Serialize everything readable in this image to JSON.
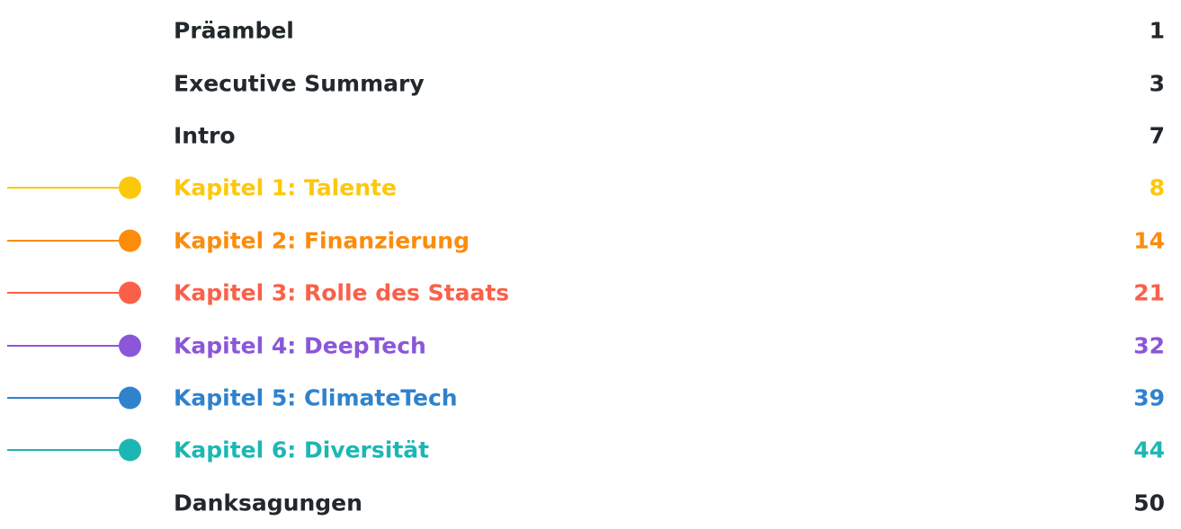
{
  "toc": {
    "entries": [
      {
        "title": "Präambel",
        "page": "1",
        "color": "#22282b",
        "marker": false
      },
      {
        "title": "Executive Summary",
        "page": "3",
        "color": "#22282b",
        "marker": false
      },
      {
        "title": "Intro",
        "page": "7",
        "color": "#22282b",
        "marker": false
      },
      {
        "title": "Kapitel 1: Talente",
        "page": "8",
        "color": "#fdc80a",
        "marker": true
      },
      {
        "title": "Kapitel 2: Finanzierung",
        "page": "14",
        "color": "#fb8c0c",
        "marker": true
      },
      {
        "title": "Kapitel 3: Rolle des Staats",
        "page": "21",
        "color": "#fa6048",
        "marker": true
      },
      {
        "title": "Kapitel 4: DeepTech",
        "page": "32",
        "color": "#8b57d8",
        "marker": true
      },
      {
        "title": "Kapitel 5: ClimateTech",
        "page": "39",
        "color": "#2f82cc",
        "marker": true
      },
      {
        "title": "Kapitel 6: Diversität",
        "page": "44",
        "color": "#1db7b3",
        "marker": true
      },
      {
        "title": "Danksagungen",
        "page": "50",
        "color": "#22282b",
        "marker": false
      }
    ]
  }
}
